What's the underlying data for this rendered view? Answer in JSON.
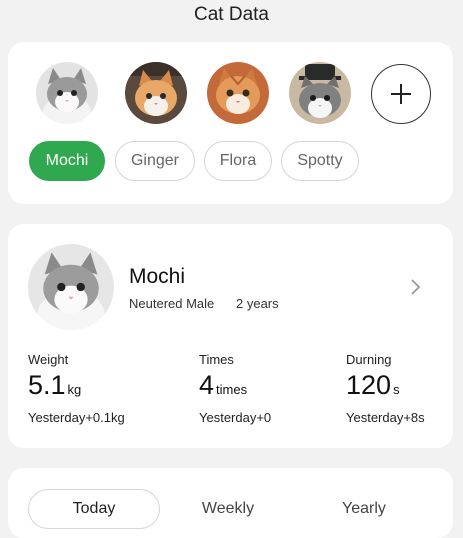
{
  "header": {
    "title": "Cat Data"
  },
  "pets": {
    "avatars": [
      "Mochi",
      "Ginger",
      "Flora",
      "Spotty"
    ],
    "add_icon": "plus-icon",
    "chips": [
      "Mochi",
      "Ginger",
      "Flora",
      "Spotty"
    ],
    "selected": "Mochi",
    "accent_color": "#2fa84f"
  },
  "profile": {
    "name": "Mochi",
    "gender": "Neutered Male",
    "age": "2 years",
    "chevron_icon": "chevron-right-icon"
  },
  "stats": [
    {
      "label": "Weight",
      "value": "5.1",
      "unit": "kg",
      "delta": "Yesterday+0.1kg"
    },
    {
      "label": "Times",
      "value": "4",
      "unit": "times",
      "delta": "Yesterday+0"
    },
    {
      "label": "Durning",
      "value": "120",
      "unit": "s",
      "delta": "Yesterday+8s"
    }
  ],
  "tabs": [
    "Today",
    "Weekly",
    "Yearly"
  ],
  "selected_tab": "Today"
}
